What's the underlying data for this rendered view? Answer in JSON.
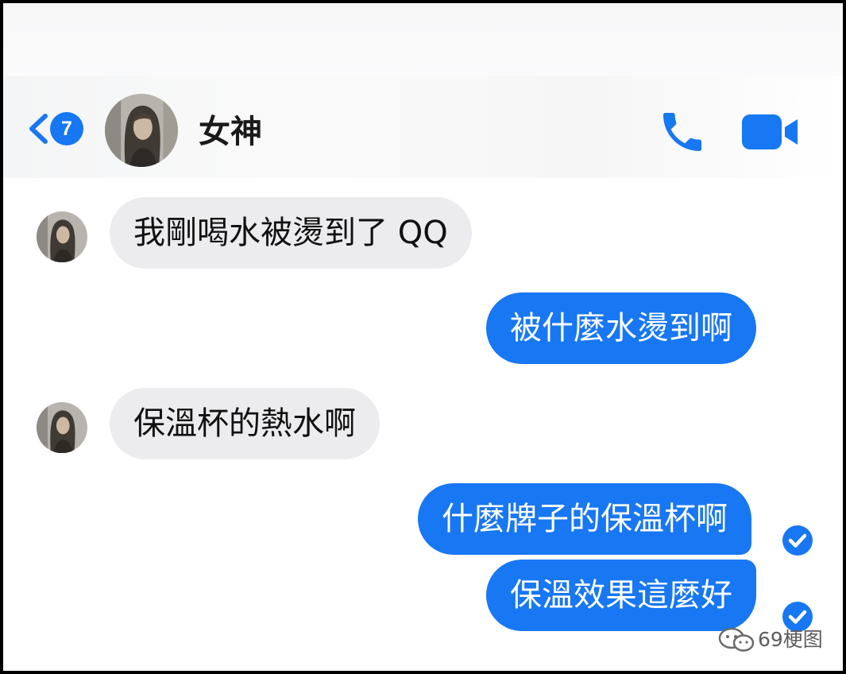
{
  "header": {
    "unread_count": "7",
    "contact_name": "女神",
    "accent_color": "#1877f2",
    "icons": {
      "back": "chevron-left-icon",
      "call": "phone-icon",
      "video": "video-camera-icon"
    }
  },
  "messages": [
    {
      "sender": "contact",
      "text": "我剛喝水被燙到了 QQ"
    },
    {
      "sender": "me",
      "text": "被什麼水燙到啊"
    },
    {
      "sender": "contact",
      "text": "保溫杯的熱水啊"
    },
    {
      "sender": "me",
      "text": "什麼牌子的保溫杯啊",
      "read": true
    },
    {
      "sender": "me",
      "text": "保溫效果這麼好",
      "read": true
    }
  ],
  "bubble_colors": {
    "incoming": "#ececee",
    "outgoing": "#1877f2"
  },
  "watermark": {
    "text": "69梗图",
    "icon": "wechat-icon"
  }
}
